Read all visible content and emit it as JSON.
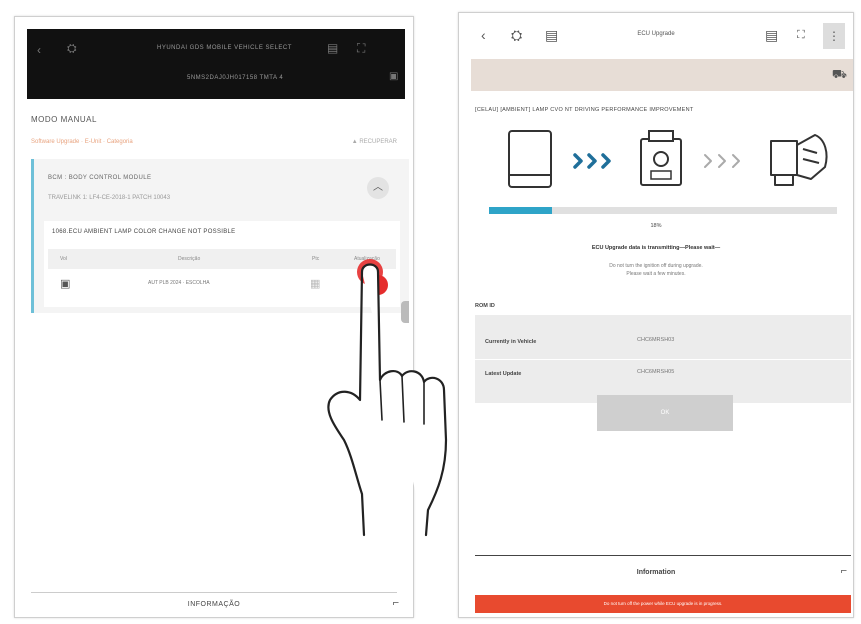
{
  "left": {
    "header": {
      "title": "HYUNDAI GDS MOBILE VEHICLE SELECT",
      "vin": "5NMS2DAJ0JH017158 TMTA 4"
    },
    "mode_title": "MODO MANUAL",
    "breadcrumb": "Software Upgrade · E-Unit · Categoria",
    "breadcrumb_right": "▲ RECUPERAR",
    "ecu_title": "BCM : BODY CONTROL MODULE",
    "ecu_sub": "TRAVELINK 1: LF4-CE-2018-1 PATCH 10043",
    "warning_label": "1068.ECU AMBIENT LAMP COLOR CHANGE NOT POSSIBLE",
    "table": {
      "headers": [
        "Vol",
        "Descrição",
        "Ptc",
        "Atualização"
      ],
      "row": [
        "",
        "AUT PLB 2024 · ESCOLHA",
        "",
        ""
      ]
    },
    "footer": "INFORMAÇÃO"
  },
  "right": {
    "title": "ECU Upgrade",
    "ecu_name": "[CELAU] [AMBIENT] LAMP CVO NT DRIVING PERFORMANCE IMPROVEMENT",
    "progress": 0.18,
    "percent_label": "18%",
    "status_text": "ECU Upgrade data is transmitting—Please wait—",
    "note1": "Do not turn the ignition off during upgrade.",
    "note2": "Please wait a few minutes.",
    "section_label": "ROM ID",
    "rows": [
      {
        "key": "Currently in Vehicle",
        "value": "CHC6MRSH03"
      },
      {
        "key": "Latest Update",
        "value": "CHC6MRSH05"
      }
    ],
    "ok_label": "OK",
    "footer": "Information",
    "bottom_bar": "Do not turn off the power while ECU upgrade is in progress."
  },
  "icons": {
    "back": "chevron-left-icon",
    "vehicle": "vehicle-icon",
    "document": "document-icon",
    "folder": "folder-icon",
    "fullscreen": "fullscreen-icon",
    "more": "more-vertical-icon",
    "car": "car-icon",
    "tablet": "tablet-icon",
    "vci": "vci-device-icon",
    "ecu": "car-engine-icon",
    "arrows": "chevron-arrows-icon"
  },
  "colors": {
    "accent_blue": "#2ea4c8",
    "alert_red": "#e84a2f",
    "tap_red": "#e52d2d",
    "band": "#e7ddd6"
  }
}
